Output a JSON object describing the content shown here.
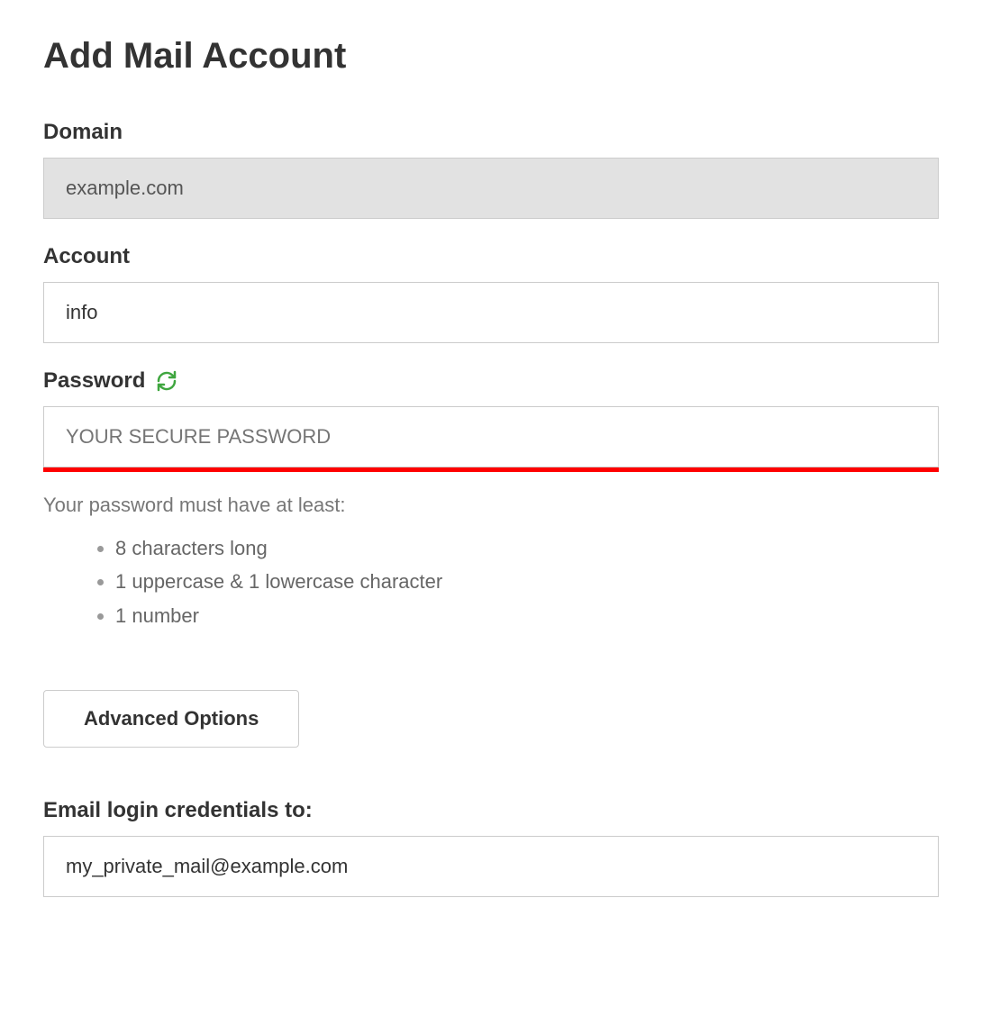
{
  "page_title": "Add Mail Account",
  "domain": {
    "label": "Domain",
    "value": "example.com"
  },
  "account": {
    "label": "Account",
    "value": "info"
  },
  "password": {
    "label": "Password",
    "placeholder": "YOUR SECURE PASSWORD",
    "helper": "Your password must have at least:",
    "requirements": [
      "8 characters long",
      "1 uppercase & 1 lowercase character",
      "1 number"
    ]
  },
  "advanced_options_label": "Advanced Options",
  "email_credentials": {
    "label": "Email login credentials to:",
    "value": "my_private_mail@example.com"
  }
}
